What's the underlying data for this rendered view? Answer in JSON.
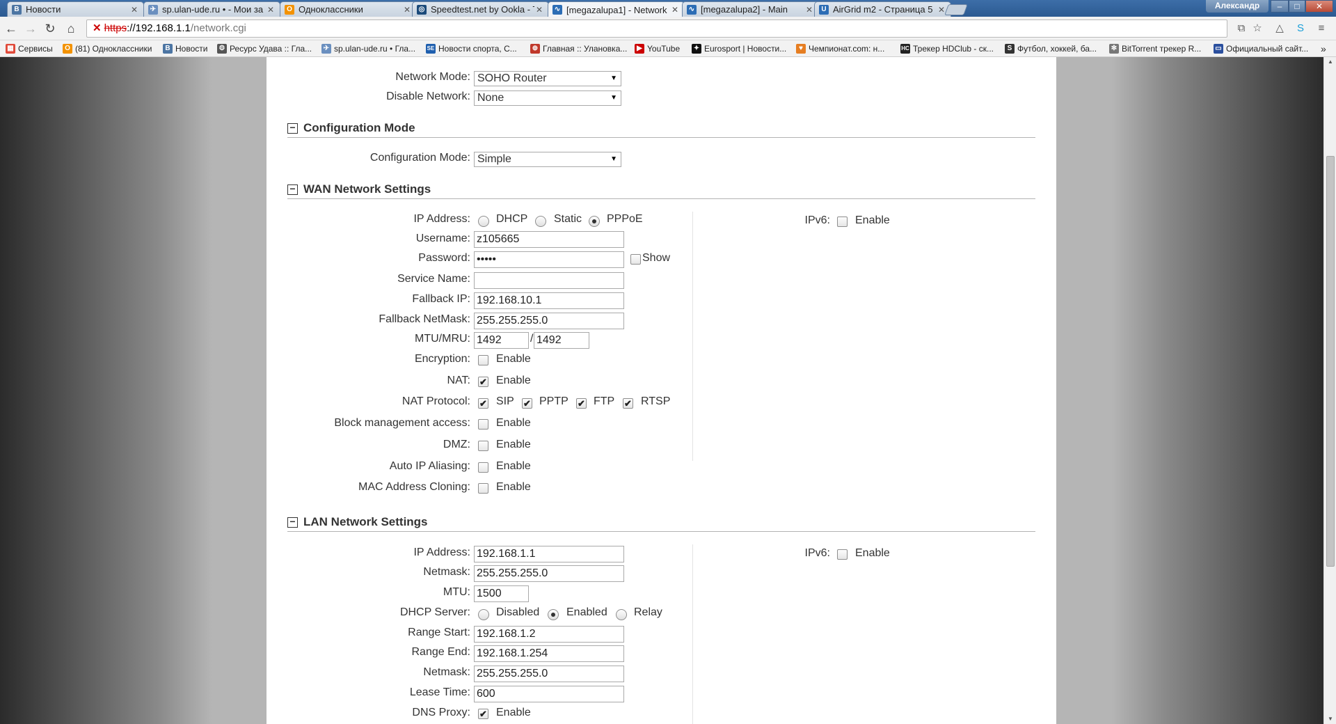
{
  "browser": {
    "tabs": [
      {
        "title": "Новости",
        "icon": "vk-icon",
        "color": "#4c75a3",
        "glyph": "B"
      },
      {
        "title": "sp.ulan-ude.ru • - Мои за",
        "icon": "forum-icon",
        "color": "#6a8fbf",
        "glyph": "✈"
      },
      {
        "title": "Одноклассники",
        "icon": "ok-icon",
        "color": "#f39200",
        "glyph": "О"
      },
      {
        "title": "Speedtest.net by Ookla - T",
        "icon": "speedtest-icon",
        "color": "#1b4a7a",
        "glyph": "◎"
      },
      {
        "title": "[megazalupa1] - Network",
        "icon": "ubnt-icon",
        "color": "#2c6db5",
        "glyph": "∿"
      },
      {
        "title": "[megazalupa2] - Main",
        "icon": "ubnt-icon",
        "color": "#2c6db5",
        "glyph": "∿"
      },
      {
        "title": "AirGrid m2 - Страница 5",
        "icon": "ubnt-doc-icon",
        "color": "#2c6db5",
        "glyph": "U"
      }
    ],
    "user_name": "Александр",
    "url": {
      "scheme": "https",
      "host": "://192.168.1.1",
      "path": "/network.cgi"
    },
    "bookmarks": [
      {
        "label": "Сервисы",
        "icon": "apps-icon",
        "color": "#e04a3a",
        "glyph": "▦"
      },
      {
        "label": "(81) Одноклассники",
        "icon": "ok-icon",
        "color": "#f39200",
        "glyph": "О"
      },
      {
        "label": "Новости",
        "icon": "vk-icon",
        "color": "#4c75a3",
        "glyph": "B"
      },
      {
        "label": "Ресурс Удава :: Гла...",
        "icon": "forum-icon",
        "color": "#555555",
        "glyph": "⚙"
      },
      {
        "label": "sp.ulan-ude.ru • Гла...",
        "icon": "forum-icon",
        "color": "#6a8fbf",
        "glyph": "✈"
      },
      {
        "label": "Новости спорта, С...",
        "icon": "sport-icon",
        "color": "#1f5fae",
        "glyph": "SE"
      },
      {
        "label": "Главная :: Улановка...",
        "icon": "site-icon",
        "color": "#c0392b",
        "glyph": "⊕"
      },
      {
        "label": "YouTube",
        "icon": "youtube-icon",
        "color": "#cc0000",
        "glyph": "▶"
      },
      {
        "label": "Eurosport | Новости...",
        "icon": "eurosport-icon",
        "color": "#111111",
        "glyph": "✦"
      },
      {
        "label": "Чемпионат.com: н...",
        "icon": "championat-icon",
        "color": "#e67e22",
        "glyph": "♥"
      },
      {
        "label": "Трекер HDClub - ск...",
        "icon": "hdclub-icon",
        "color": "#222222",
        "glyph": "HC"
      },
      {
        "label": "Футбол, хоккей, ба...",
        "icon": "sports-icon",
        "color": "#333333",
        "glyph": "S"
      },
      {
        "label": "BitTorrent трекер R...",
        "icon": "tracker-icon",
        "color": "#777777",
        "glyph": "✻"
      },
      {
        "label": "Официальный сайт...",
        "icon": "official-icon",
        "color": "#2a4f9e",
        "glyph": "▭"
      }
    ]
  },
  "network": {
    "network_mode_label": "Network Mode:",
    "network_mode_value": "SOHO Router",
    "disable_network_label": "Disable Network:",
    "disable_network_value": "None"
  },
  "config_mode": {
    "section_title": "Configuration Mode",
    "label": "Configuration Mode:",
    "value": "Simple"
  },
  "wan": {
    "section_title": "WAN Network Settings",
    "ip_address_label": "IP Address:",
    "ip_options": [
      "DHCP",
      "Static",
      "PPPoE"
    ],
    "ip_selected": "PPPoE",
    "username_label": "Username:",
    "username_value": "z105665",
    "password_label": "Password:",
    "password_value": "•••••",
    "show_label": "Show",
    "service_name_label": "Service Name:",
    "service_name_value": "",
    "fallback_ip_label": "Fallback IP:",
    "fallback_ip_value": "192.168.10.1",
    "fallback_netmask_label": "Fallback NetMask:",
    "fallback_netmask_value": "255.255.255.0",
    "mtu_mru_label": "MTU/MRU:",
    "mtu_value": "1492",
    "mru_value": "1492",
    "mtu_sep": "/",
    "encryption_label": "Encryption:",
    "nat_label": "NAT:",
    "nat_protocol_label": "NAT Protocol:",
    "nat_protocols": [
      "SIP",
      "PPTP",
      "FTP",
      "RTSP"
    ],
    "block_mgmt_label": "Block management access:",
    "dmz_label": "DMZ:",
    "auto_ip_label": "Auto IP Aliasing:",
    "mac_clone_label": "MAC Address Cloning:",
    "enable_label": "Enable",
    "ipv6_label": "IPv6:",
    "check_mark": "✔"
  },
  "lan": {
    "section_title": "LAN Network Settings",
    "ip_address_label": "IP Address:",
    "ip_address_value": "192.168.1.1",
    "netmask_label": "Netmask:",
    "netmask_value": "255.255.255.0",
    "mtu_label": "MTU:",
    "mtu_value": "1500",
    "dhcp_label": "DHCP Server:",
    "dhcp_options": [
      "Disabled",
      "Enabled",
      "Relay"
    ],
    "dhcp_selected": "Enabled",
    "range_start_label": "Range Start:",
    "range_start_value": "192.168.1.2",
    "range_end_label": "Range End:",
    "range_end_value": "192.168.1.254",
    "netmask2_label": "Netmask:",
    "netmask2_value": "255.255.255.0",
    "lease_label": "Lease Time:",
    "lease_value": "600",
    "dns_proxy_label": "DNS Proxy:",
    "enable_label": "Enable",
    "ipv6_label": "IPv6:",
    "check_mark": "✔"
  }
}
